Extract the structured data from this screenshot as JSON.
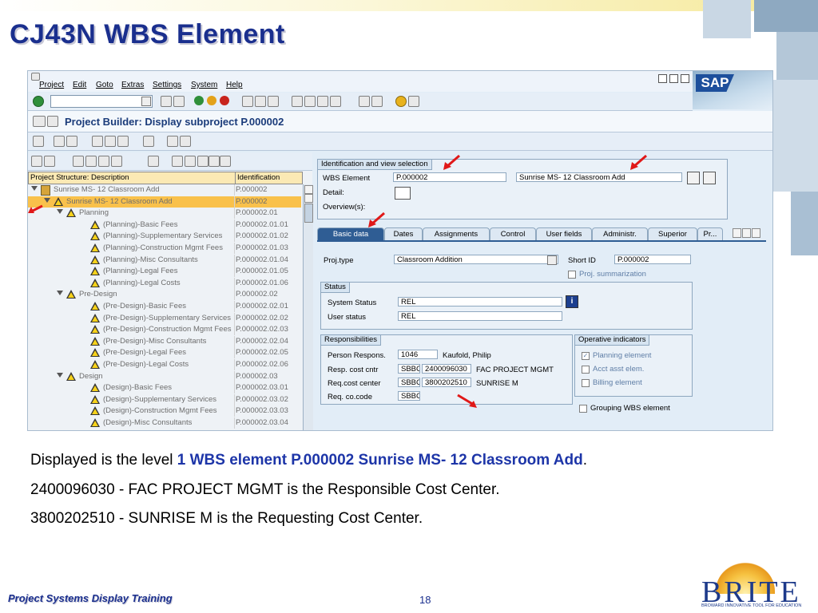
{
  "slide": {
    "title": "CJ43N WBS Element",
    "footer_left": "Project Systems Display Training",
    "page_number": "18",
    "body_lines": [
      {
        "prefix": "Displayed is the level ",
        "highlight": "1 WBS element P.000002 Sunrise MS- 12 Classroom Add",
        "suffix": "."
      },
      {
        "text": "2400096030 - FAC PROJECT MGMT is the Responsible Cost Center."
      },
      {
        "text": "3800202510 - SUNRISE M is the Requesting Cost Center."
      }
    ],
    "logo": {
      "text": "BRITE",
      "tagline": "BROWARD INNOVATIVE TOOL FOR EDUCATION"
    }
  },
  "sap": {
    "menu": [
      "Project",
      "Edit",
      "Goto",
      "Extras",
      "Settings",
      "System",
      "Help"
    ],
    "logo_text": "SAP",
    "screen_title": "Project Builder: Display subproject P.000002",
    "tree": {
      "col_description": "Project Structure: Description",
      "col_identification": "Identification",
      "rows": [
        {
          "label": "Sunrise MS- 12 Classroom Add",
          "id": "P.000002",
          "level": 0,
          "icon": "project",
          "expand": true,
          "selected": false
        },
        {
          "label": "Sunrise MS- 12 Classroom Add",
          "id": "P.000002",
          "level": 1,
          "icon": "wbs",
          "expand": true,
          "selected": true
        },
        {
          "label": "Planning",
          "id": "P.000002.01",
          "level": 2,
          "icon": "wbs",
          "expand": true,
          "selected": false
        },
        {
          "label": "(Planning)-Basic Fees",
          "id": "P.000002.01.01",
          "level": 3,
          "icon": "wbs",
          "expand": false,
          "selected": false
        },
        {
          "label": "(Planning)-Supplementary Services",
          "id": "P.000002.01.02",
          "level": 3,
          "icon": "wbs",
          "expand": false,
          "selected": false
        },
        {
          "label": "(Planning)-Construction Mgmt Fees",
          "id": "P.000002.01.03",
          "level": 3,
          "icon": "wbs",
          "expand": false,
          "selected": false
        },
        {
          "label": "(Planning)-Misc Consultants",
          "id": "P.000002.01.04",
          "level": 3,
          "icon": "wbs",
          "expand": false,
          "selected": false
        },
        {
          "label": "(Planning)-Legal Fees",
          "id": "P.000002.01.05",
          "level": 3,
          "icon": "wbs",
          "expand": false,
          "selected": false
        },
        {
          "label": "(Planning)-Legal Costs",
          "id": "P.000002.01.06",
          "level": 3,
          "icon": "wbs",
          "expand": false,
          "selected": false
        },
        {
          "label": "Pre-Design",
          "id": "P.000002.02",
          "level": 2,
          "icon": "wbs",
          "expand": true,
          "selected": false
        },
        {
          "label": "(Pre-Design)-Basic Fees",
          "id": "P.000002.02.01",
          "level": 3,
          "icon": "wbs",
          "expand": false,
          "selected": false
        },
        {
          "label": "(Pre-Design)-Supplementary Services",
          "id": "P.000002.02.02",
          "level": 3,
          "icon": "wbs",
          "expand": false,
          "selected": false
        },
        {
          "label": "(Pre-Design)-Construction Mgmt Fees",
          "id": "P.000002.02.03",
          "level": 3,
          "icon": "wbs",
          "expand": false,
          "selected": false
        },
        {
          "label": "(Pre-Design)-Misc Consultants",
          "id": "P.000002.02.04",
          "level": 3,
          "icon": "wbs",
          "expand": false,
          "selected": false
        },
        {
          "label": "(Pre-Design)-Legal Fees",
          "id": "P.000002.02.05",
          "level": 3,
          "icon": "wbs",
          "expand": false,
          "selected": false
        },
        {
          "label": "(Pre-Design)-Legal Costs",
          "id": "P.000002.02.06",
          "level": 3,
          "icon": "wbs",
          "expand": false,
          "selected": false
        },
        {
          "label": "Design",
          "id": "P.000002.03",
          "level": 2,
          "icon": "wbs",
          "expand": true,
          "selected": false
        },
        {
          "label": "(Design)-Basic Fees",
          "id": "P.000002.03.01",
          "level": 3,
          "icon": "wbs",
          "expand": false,
          "selected": false
        },
        {
          "label": "(Design)-Supplementary Services",
          "id": "P.000002.03.02",
          "level": 3,
          "icon": "wbs",
          "expand": false,
          "selected": false
        },
        {
          "label": "(Design)-Construction Mgmt Fees",
          "id": "P.000002.03.03",
          "level": 3,
          "icon": "wbs",
          "expand": false,
          "selected": false
        },
        {
          "label": "(Design)-Misc Consultants",
          "id": "P.000002.03.04",
          "level": 3,
          "icon": "wbs",
          "expand": false,
          "selected": false
        }
      ]
    },
    "ident": {
      "title": "Identification and view selection",
      "wbs_label": "WBS Element",
      "wbs_value": "P.000002",
      "wbs_desc": "Sunrise MS- 12 Classroom Add",
      "detail_label": "Detail:",
      "overview_label": "Overview(s):"
    },
    "tabs": [
      "Basic data",
      "Dates",
      "Assignments",
      "Control",
      "User fields",
      "Administr.",
      "Superior",
      "Pr..."
    ],
    "basic": {
      "projtype_label": "Proj.type",
      "projtype_value": "Classroom Addition",
      "shortid_label": "Short ID",
      "shortid_value": "P.000002",
      "proj_summ_label": "Proj. summarization"
    },
    "status": {
      "title": "Status",
      "system_label": "System Status",
      "system_value": "REL",
      "user_label": "User status",
      "user_value": "REL"
    },
    "resp": {
      "title": "Responsibilities",
      "person_label": "Person Respons.",
      "person_no": "1046",
      "person_name": "Kaufold, Philip",
      "respcc_label": "Resp. cost cntr",
      "respcc_co": "SBBC",
      "respcc_val": "2400096030",
      "respcc_name": "FAC PROJECT MGMT",
      "reqcc_label": "Req.cost center",
      "reqcc_co": "SBBC",
      "reqcc_val": "3800202510",
      "reqcc_name": "SUNRISE M",
      "reqco_label": "Req. co.code",
      "reqco_val": "SBBC"
    },
    "operative": {
      "title": "Operative indicators",
      "planning": "Planning element",
      "acct": "Acct asst elem.",
      "billing": "Billing element",
      "grouping": "Grouping WBS element"
    }
  }
}
